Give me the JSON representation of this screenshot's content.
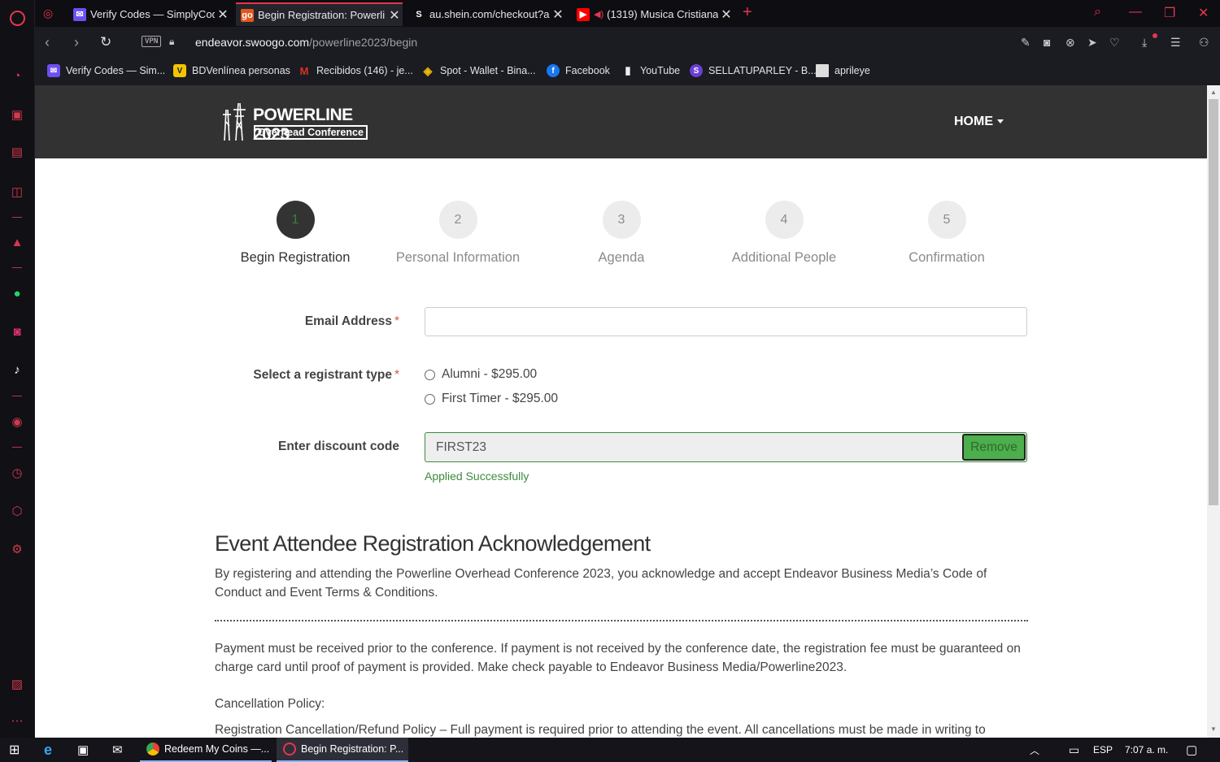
{
  "browser": {
    "tabs": [
      {
        "title": "Verify Codes — SimplyCod",
        "favicon_color": "#6f4ef2",
        "active": false
      },
      {
        "title": "Begin Registration: Powerli",
        "favicon_text": "go",
        "favicon_color": "#e0571c",
        "active": true
      },
      {
        "title": "au.shein.com/checkout?aut",
        "favicon_text": "S",
        "active": false
      },
      {
        "title": "(1319) Musica Cristiana",
        "favicon_color": "#ff0000",
        "active": false
      }
    ],
    "url_host": "endeavor.swoogo.com",
    "url_path": "/powerline2023/begin",
    "vpn_label": "VPN",
    "bookmarks": [
      {
        "label": "Verify Codes — Sim...",
        "icon_color": "#6f4ef2"
      },
      {
        "label": "BDVenlínea personas",
        "icon_color": "#f4c400"
      },
      {
        "label": "Recibidos (146) - je...",
        "icon_text": "M",
        "icon_color": "#d93025"
      },
      {
        "label": "Spot - Wallet - Bina...",
        "icon_color": "#f0b90b"
      },
      {
        "label": "Facebook",
        "icon_text": "f",
        "icon_color": "#1877f2"
      },
      {
        "label": "YouTube",
        "icon_color": "#eeeeee"
      },
      {
        "label": "SELLATUPARLEY - B...",
        "icon_text": "S",
        "icon_color": "#6a3fd6"
      },
      {
        "label": "aprileye",
        "icon_color": "#dddddd"
      }
    ]
  },
  "site": {
    "logo_name": "POWERLINE 2023",
    "logo_sub": "Overhead Conference",
    "nav_home": "HOME"
  },
  "steps": [
    {
      "number": "1",
      "label": "Begin Registration",
      "current": true
    },
    {
      "number": "2",
      "label": "Personal Information",
      "current": false
    },
    {
      "number": "3",
      "label": "Agenda",
      "current": false
    },
    {
      "number": "4",
      "label": "Additional People",
      "current": false
    },
    {
      "number": "5",
      "label": "Confirmation",
      "current": false
    }
  ],
  "form": {
    "email_label": "Email Address",
    "email_value": "",
    "required_mark": "*",
    "registrant_label": "Select a registrant type",
    "registrant_options": [
      "Alumni - $295.00",
      "First Timer - $295.00"
    ],
    "discount_label": "Enter discount code",
    "discount_value": "FIRST23",
    "remove_label": "Remove",
    "applied_text": "Applied Successfully"
  },
  "acknowledgement": {
    "title": "Event Attendee Registration Acknowledgement",
    "intro": "By registering and attending the Powerline Overhead Conference 2023, you acknowledge and accept Endeavor Business Media’s Code of Conduct and Event Terms & Conditions.",
    "payment": "Payment must be received prior to the conference. If payment is not received by the conference date, the registration fee must be guaranteed on charge card until proof of payment is provided. Make check payable to Endeavor Business Media/Powerline2023.",
    "cancellation_heading": "Cancellation Policy:",
    "cancellation_text": "Registration Cancellation/Refund Policy – Full payment is required prior to attending the event. All cancellations must be made in writing to"
  },
  "taskbar": {
    "apps": [
      {
        "label": "Redeem My Coins —...",
        "icon_color": "#f2a600"
      },
      {
        "label": "Begin Registration: P...",
        "icon_color": "#e6364e"
      }
    ],
    "language": "ESP",
    "time": "7:07 a. m."
  },
  "colors": {
    "accent": "#e6364e",
    "header_bg": "#323232",
    "success": "#3c8c3c",
    "remove_btn": "#4cae4c"
  }
}
